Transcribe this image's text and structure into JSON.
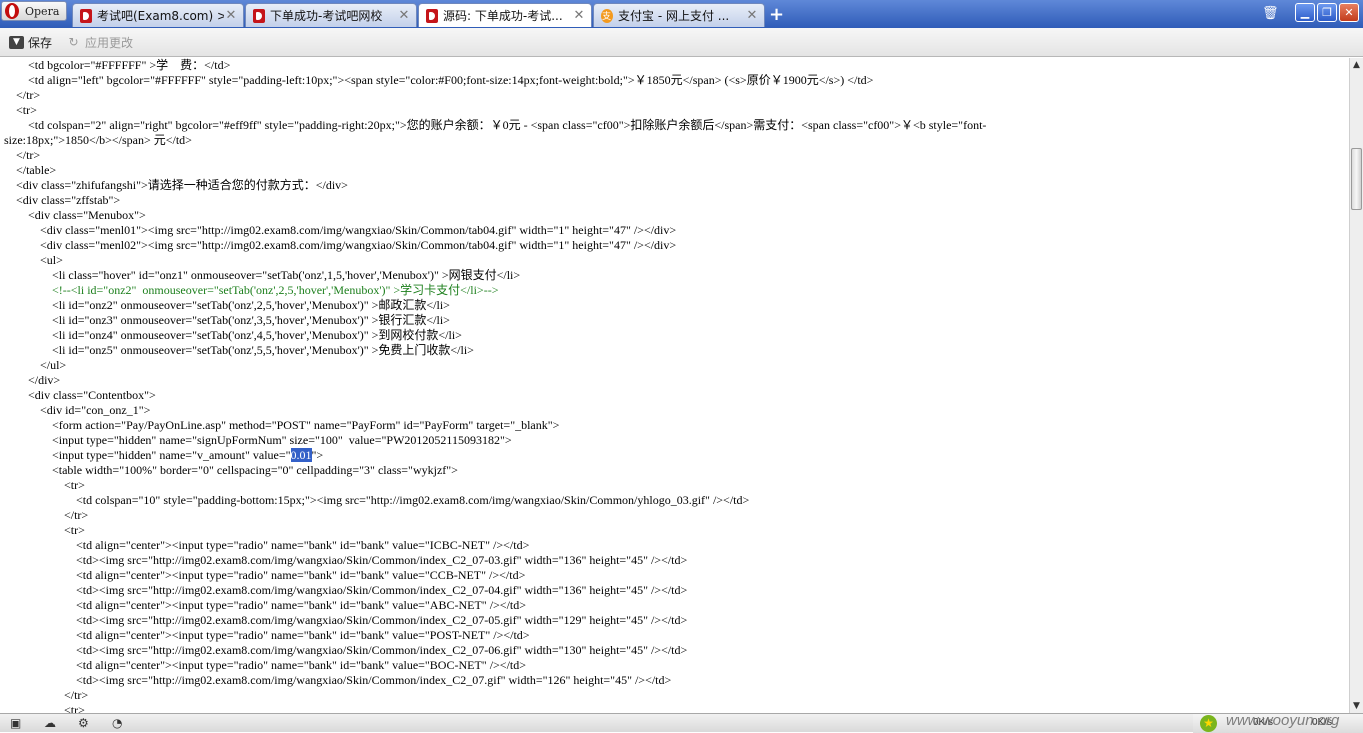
{
  "browser": {
    "menu_label": "Opera",
    "tabs": [
      {
        "title": "考试吧(Exam8.com) >...",
        "icon": "exam8-favicon",
        "active": false
      },
      {
        "title": "下单成功-考试吧网校",
        "icon": "exam8-favicon",
        "active": false
      },
      {
        "title": "源码: 下单成功-考试...",
        "icon": "exam8-favicon",
        "active": true
      },
      {
        "title": "支付宝 - 网上支付 ...",
        "icon": "alipay-favicon",
        "active": false
      }
    ],
    "new_tab_glyph": "+"
  },
  "toolbar": {
    "save_label": "保存",
    "apply_label": "应用更改"
  },
  "source_lines": [
    "        <td bgcolor=\"#FFFFFF\" >学　费：</td>",
    "        <td align=\"left\" bgcolor=\"#FFFFFF\" style=\"padding-left:10px;\"><span style=\"color:#F00;font-size:14px;font-weight:bold;\">￥1850元</span> (<s>原价￥1900元</s>) </td>",
    "    </tr>",
    "    <tr>",
    "        <td colspan=\"2\" align=\"right\" bgcolor=\"#eff9ff\" style=\"padding-right:20px;\">您的账户余额：￥0元 - <span class=\"cf00\">扣除账户余额后</span>需支付：<span class=\"cf00\">￥<b style=\"font-",
    "size:18px;\">1850</b></span> 元</td>",
    "    </tr>",
    "    </table>",
    "    <div class=\"zhifufangshi\">请选择一种适合您的付款方式：</div>",
    "    <div class=\"zffstab\">",
    "        <div class=\"Menubox\">",
    "            <div class=\"menl01\"><img src=\"http://img02.exam8.com/img/wangxiao/Skin/Common/tab04.gif\" width=\"1\" height=\"47\" /></div>",
    "            <div class=\"menl02\"><img src=\"http://img02.exam8.com/img/wangxiao/Skin/Common/tab04.gif\" width=\"1\" height=\"47\" /></div>",
    "            <ul>",
    "                <li class=\"hover\" id=\"onz1\" onmouseover=\"setTab('onz',1,5,'hover','Menubox')\" >网银支付</li>",
    "                <!--<li id=\"onz2\"  onmouseover=\"setTab('onz',2,5,'hover','Menubox')\" >学习卡支付</li>-->",
    "                <li id=\"onz2\" onmouseover=\"setTab('onz',2,5,'hover','Menubox')\" >邮政汇款</li>",
    "                <li id=\"onz3\" onmouseover=\"setTab('onz',3,5,'hover','Menubox')\" >银行汇款</li>",
    "                <li id=\"onz4\" onmouseover=\"setTab('onz',4,5,'hover','Menubox')\" >到网校付款</li>",
    "                <li id=\"onz5\" onmouseover=\"setTab('onz',5,5,'hover','Menubox')\" >免费上门收款</li>",
    "            </ul>",
    "        </div>",
    "        <div class=\"Contentbox\">",
    "            <div id=\"con_onz_1\">",
    "                <form action=\"Pay/PayOnLine.asp\" method=\"POST\" name=\"PayForm\" id=\"PayForm\" target=\"_blank\">",
    "                <input type=\"hidden\" name=\"signUpFormNum\" size=\"100\"  value=\"PW2012052115093182\">",
    "                <input type=\"hidden\" name=\"v_amount\" value=\"",
    "                <table width=\"100%\" border=\"0\" cellspacing=\"0\" cellpadding=\"3\" class=\"wykjzf\">",
    "                    <tr>",
    "                        <td colspan=\"10\" style=\"padding-bottom:15px;\"><img src=\"http://img02.exam8.com/img/wangxiao/Skin/Common/yhlogo_03.gif\" /></td>",
    "                    </tr>",
    "                    <tr>",
    "                        <td align=\"center\"><input type=\"radio\" name=\"bank\" id=\"bank\" value=\"ICBC-NET\" /></td>",
    "                        <td><img src=\"http://img02.exam8.com/img/wangxiao/Skin/Common/index_C2_07-03.gif\" width=\"136\" height=\"45\" /></td>",
    "                        <td align=\"center\"><input type=\"radio\" name=\"bank\" id=\"bank\" value=\"CCB-NET\" /></td>",
    "                        <td><img src=\"http://img02.exam8.com/img/wangxiao/Skin/Common/index_C2_07-04.gif\" width=\"136\" height=\"45\" /></td>",
    "                        <td align=\"center\"><input type=\"radio\" name=\"bank\" id=\"bank\" value=\"ABC-NET\" /></td>",
    "                        <td><img src=\"http://img02.exam8.com/img/wangxiao/Skin/Common/index_C2_07-05.gif\" width=\"129\" height=\"45\" /></td>",
    "                        <td align=\"center\"><input type=\"radio\" name=\"bank\" id=\"bank\" value=\"POST-NET\" /></td>",
    "                        <td><img src=\"http://img02.exam8.com/img/wangxiao/Skin/Common/index_C2_07-06.gif\" width=\"130\" height=\"45\" /></td>",
    "                        <td align=\"center\"><input type=\"radio\" name=\"bank\" id=\"bank\" value=\"BOC-NET\" /></td>",
    "                        <td><img src=\"http://img02.exam8.com/img/wangxiao/Skin/Common/index_C2_07.gif\" width=\"126\" height=\"45\" /></td>",
    "                    </tr>",
    "                    <tr>"
  ],
  "selected_text": "0.01",
  "selected_suffix": "\">",
  "statusbar": {
    "left_icons": [
      "panels-icon",
      "cloud-icon",
      "network-icon",
      "speed-dial-icon"
    ],
    "traffic_left": "0K/s",
    "traffic_right": "0K/s",
    "watermark": "www.wooyun.org"
  },
  "colors": {
    "tabbar": "#3a67c4",
    "selection": "#3360c8",
    "comment": "#1c7f1c"
  }
}
